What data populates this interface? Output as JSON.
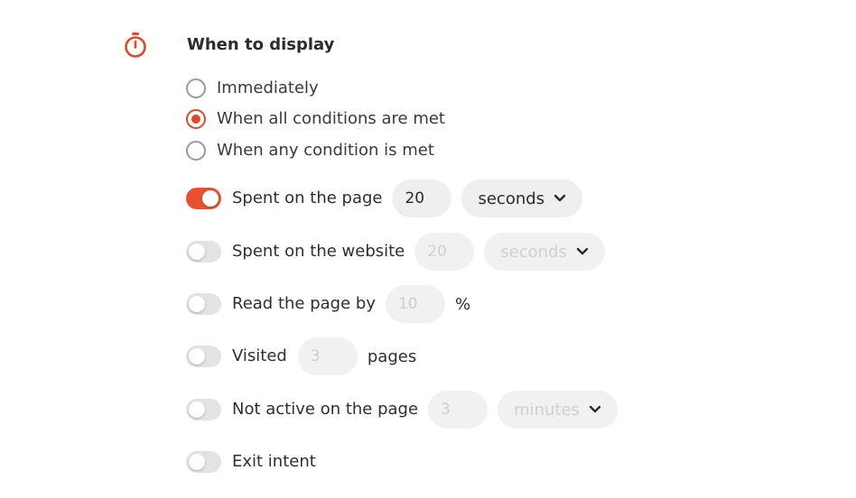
{
  "section": {
    "title": "When to display",
    "icon": "stopwatch-icon",
    "accent_color": "#e04a2b"
  },
  "display_mode": {
    "options": [
      {
        "label": "Immediately",
        "selected": false
      },
      {
        "label": "When all conditions are met",
        "selected": true
      },
      {
        "label": "When any condition is met",
        "selected": false
      }
    ]
  },
  "conditions": {
    "time_on_page": {
      "label": "Spent on the page",
      "enabled": true,
      "value": "20",
      "unit": "seconds"
    },
    "time_on_website": {
      "label": "Spent on the website",
      "enabled": false,
      "value": "20",
      "unit": "seconds"
    },
    "scroll_depth": {
      "label": "Read the page by",
      "enabled": false,
      "value": "10",
      "suffix": "%"
    },
    "pages_visited": {
      "label": "Visited",
      "enabled": false,
      "value": "3",
      "suffix": "pages"
    },
    "inactivity": {
      "label": "Not active on the page",
      "enabled": false,
      "value": "3",
      "unit": "minutes"
    },
    "exit_intent": {
      "label": "Exit intent",
      "enabled": false
    }
  }
}
